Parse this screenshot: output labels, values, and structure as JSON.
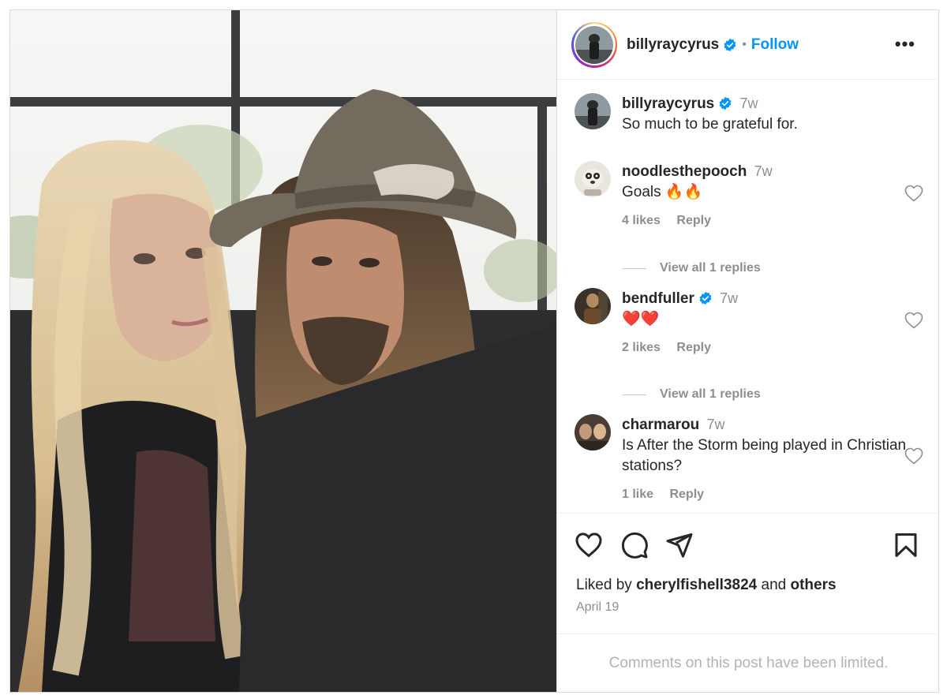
{
  "post": {
    "author": "billyraycyrus",
    "follow_label": "Follow",
    "separator": "•",
    "more_label": "•••",
    "caption": {
      "username": "billyraycyrus",
      "time": "7w",
      "text": "So much to be grateful for."
    },
    "comments": [
      {
        "username": "noodlesthepooch",
        "verified": false,
        "time": "7w",
        "text": "Goals 🔥🔥",
        "likes": "4 likes",
        "reply": "Reply",
        "view_replies": "View all 1 replies"
      },
      {
        "username": "bendfuller",
        "verified": true,
        "time": "7w",
        "text": "❤️❤️",
        "likes": "2 likes",
        "reply": "Reply",
        "view_replies": "View all 1 replies"
      },
      {
        "username": "charmarou",
        "verified": false,
        "time": "7w",
        "text": "Is After the Storm being played in Christian stations?",
        "likes": "1 like",
        "reply": "Reply"
      }
    ],
    "liked_by": {
      "prefix": "Liked by",
      "user": "cherylfishell3824",
      "middle": "and",
      "suffix": "others"
    },
    "date": "April 19",
    "limited_notice": "Comments on this post have been limited."
  },
  "icons": [
    "more-options-icon",
    "verified-badge-icon",
    "heart-icon",
    "comment-icon",
    "share-icon",
    "bookmark-icon"
  ],
  "colors": {
    "link_blue": "#0095f6",
    "verified_blue": "#0095f6",
    "muted": "#8e8e8e",
    "text": "#262626",
    "border": "#dbdbdb"
  }
}
